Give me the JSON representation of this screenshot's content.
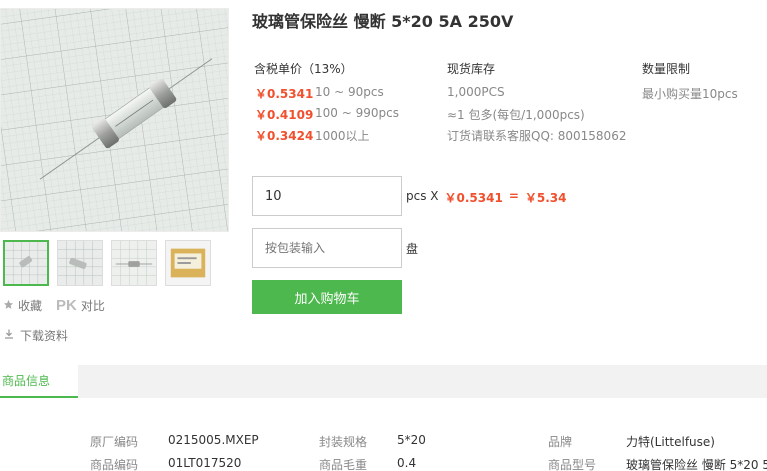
{
  "product": {
    "title": "玻璃管保险丝 慢断 5*20 5A 250V"
  },
  "pricing": {
    "header": "含税单价（13%）",
    "tiers": [
      {
        "price": "￥0.5341",
        "range": "10 ~ 90pcs"
      },
      {
        "price": "￥0.4109",
        "range": "100 ~ 990pcs"
      },
      {
        "price": "￥0.3424",
        "range": "1000以上"
      }
    ]
  },
  "stock": {
    "header": "现货库存",
    "quantity": "1,000PCS",
    "package": "≈1 包多(每包/1,000pcs)",
    "contact": "订货请联系客服QQ: 800158062"
  },
  "limit": {
    "header": "数量限制",
    "text": "最小购买量10pcs"
  },
  "order": {
    "quantity_value": "10",
    "unit_label": "pcs X",
    "unit_price": "￥0.5341",
    "equals": "=",
    "total": "￥5.34",
    "pack_placeholder": "按包装输入",
    "pack_unit": "盘",
    "add_to_cart": "加入购物车"
  },
  "side_actions": {
    "favorite": "收藏",
    "pk": "PK",
    "compare": "对比",
    "download": "下载资料"
  },
  "tabs": {
    "product_info": "商品信息"
  },
  "info": {
    "row1": [
      {
        "label": "原厂编码",
        "value": "0215005.MXEP"
      },
      {
        "label": "封装规格",
        "value": "5*20"
      },
      {
        "label": "品牌",
        "value": "力特(Littelfuse)"
      }
    ],
    "row2": [
      {
        "label": "商品编码",
        "value": "01LT017520"
      },
      {
        "label": "商品毛重",
        "value": "0.4"
      },
      {
        "label": "商品型号",
        "value": "玻璃管保险丝 慢断 5*20 5..."
      }
    ]
  },
  "colors": {
    "accent_green": "#4db84d",
    "price_red": "#f0502d"
  },
  "icons": {
    "favorite": "star-icon",
    "download": "download-icon"
  }
}
